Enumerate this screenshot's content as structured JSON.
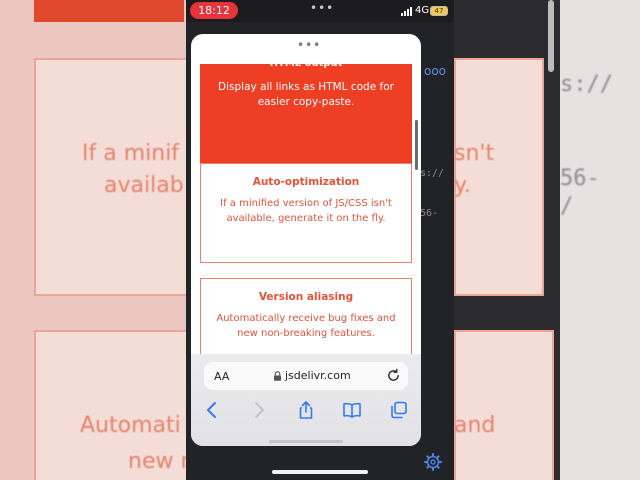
{
  "status_bar": {
    "time": "18:12",
    "network": "4G",
    "battery": "47"
  },
  "sheet": {
    "cards": [
      {
        "title": "HTML output",
        "description": "Display all links as HTML code for easier copy-paste.",
        "highlighted": true
      },
      {
        "title": "Auto-optimization",
        "description": "If a minified version of JS/CSS isn't available, generate it on the fly."
      },
      {
        "title": "Version aliasing",
        "description": "Automatically receive bug fixes and new non-breaking features."
      }
    ]
  },
  "browser": {
    "text_size_label": "AA",
    "url": "jsdelivr.com"
  },
  "background": {
    "left_lines": [
      "If a minif",
      "availab",
      "Automati",
      "new n"
    ],
    "right_lines": [
      "sn't",
      "y.",
      "and"
    ],
    "code_lines": [
      "s://",
      "56-",
      "/"
    ],
    "under_code_lines": [
      "s://",
      "56-"
    ]
  },
  "colors": {
    "accent": "#ee3f24",
    "accent_text": "#e2533a"
  }
}
